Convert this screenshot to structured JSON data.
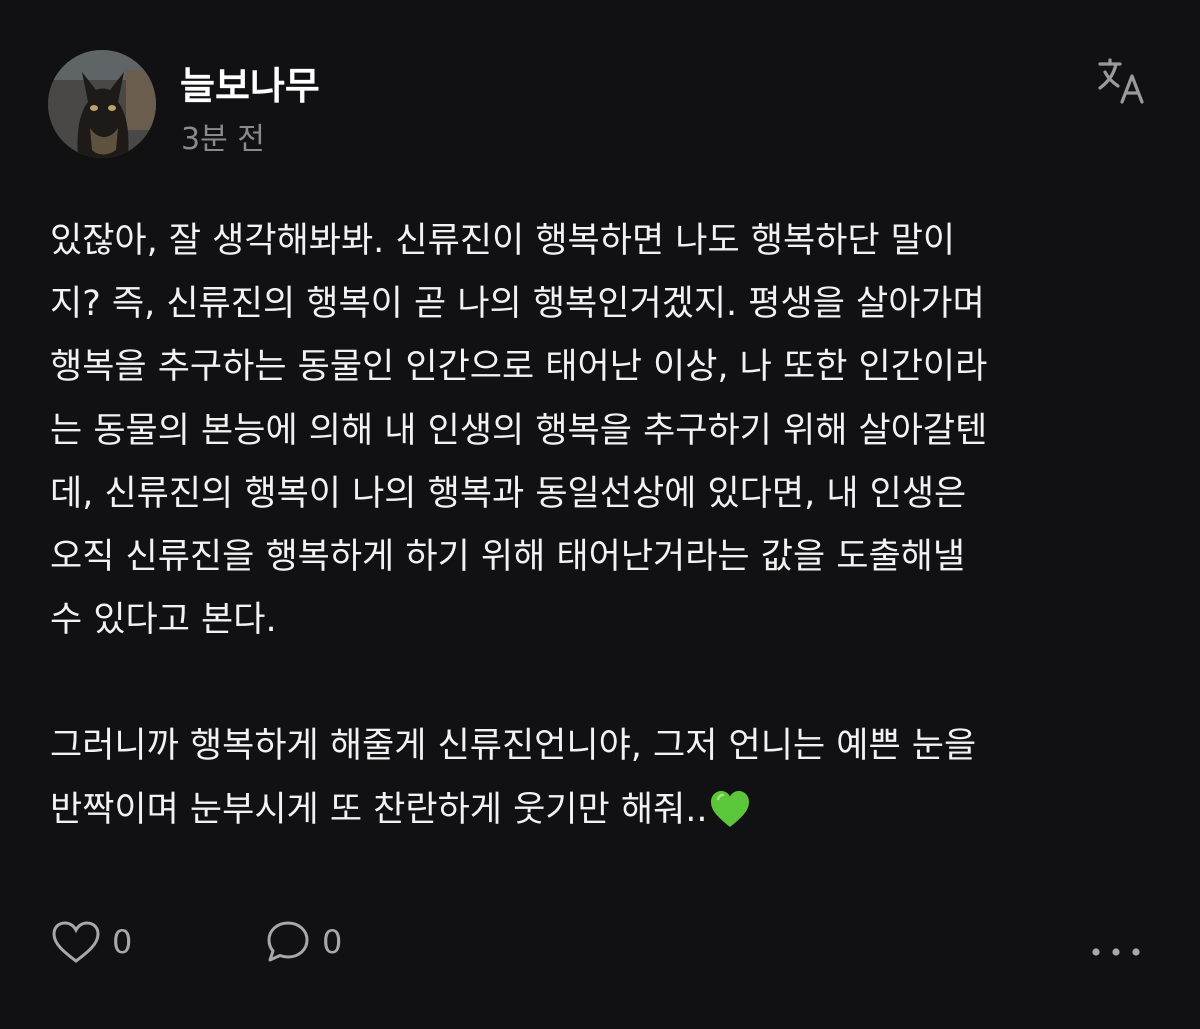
{
  "post": {
    "author": "늘보나무",
    "timestamp": "3분 전",
    "paragraphs": [
      "있잖아, 잘 생각해봐봐. 신류진이 행복하면 나도 행복하단 말이\n지? 즉, 신류진의 행복이 곧 나의 행복인거겠지. 평생을 살아가며\n행복을 추구하는 동물인 인간으로 태어난 이상, 나 또한 인간이라\n는 동물의 본능에 의해 내 인생의 행복을 추구하기 위해 살아갈텐\n데, 신류진의 행복이 나의 행복과 동일선상에 있다면, 내 인생은\n오직 신류진을 행복하게 하기 위해 태어난거라는 값을 도출해낼\n수 있다고 본다.",
      "그러니까 행복하게 해줄게 신류진언니야, 그저 언니는 예쁜 눈을\n반짝이며 눈부시게 또 찬란하게 웃기만 해줘.."
    ],
    "emoji": "green-heart",
    "likes": "0",
    "replies": "0"
  },
  "icons": {
    "translate": "translate-icon",
    "like": "heart-outline-icon",
    "reply": "speech-bubble-icon",
    "more": "more-horizontal-icon"
  },
  "colors": {
    "background": "#111013",
    "text": "#f2f2f2",
    "muted": "#8a8a8e",
    "emoji_green": "#5cc63a"
  }
}
